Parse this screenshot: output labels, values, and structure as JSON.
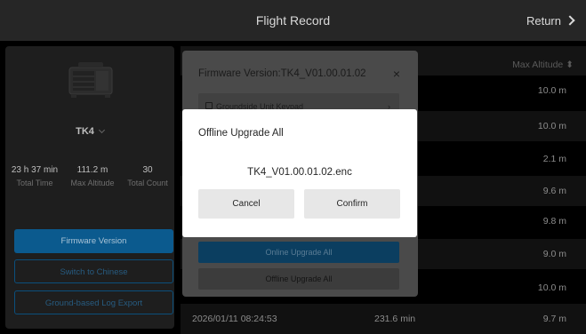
{
  "header": {
    "title": "Flight Record",
    "return_label": "Return"
  },
  "device": {
    "name": "TK4",
    "stats": [
      {
        "value": "23 h 37 min",
        "label": "Total Time"
      },
      {
        "value": "111.2 m",
        "label": "Max Altitude"
      },
      {
        "value": "30",
        "label": "Total Count"
      }
    ],
    "buttons": {
      "firmware": "Firmware Version",
      "switch_lang": "Switch to Chinese",
      "log_export": "Ground-based Log Export"
    }
  },
  "table": {
    "max_altitude_header": "Max Altitude",
    "rows": [
      {
        "altitude": "10.0 m"
      },
      {
        "altitude": "10.0 m"
      },
      {
        "altitude": "2.1 m"
      },
      {
        "altitude": "9.6 m"
      },
      {
        "altitude": "9.8 m"
      },
      {
        "altitude": "9.0 m"
      },
      {
        "altitude": "10.0 m"
      },
      {
        "date": "2026/01/11 08:24:53",
        "duration": "231.6 min",
        "altitude": "9.7 m"
      }
    ]
  },
  "firmware_dialog": {
    "title": "Firmware Version:TK4_V01.00.01.02",
    "item_label": "Groundside Unit Keypad",
    "online_upgrade": "Online Upgrade All",
    "offline_upgrade": "Offline Upgrade All"
  },
  "modal": {
    "title": "Offline Upgrade All",
    "filename": "TK4_V01.00.01.02.enc",
    "cancel": "Cancel",
    "confirm": "Confirm"
  }
}
